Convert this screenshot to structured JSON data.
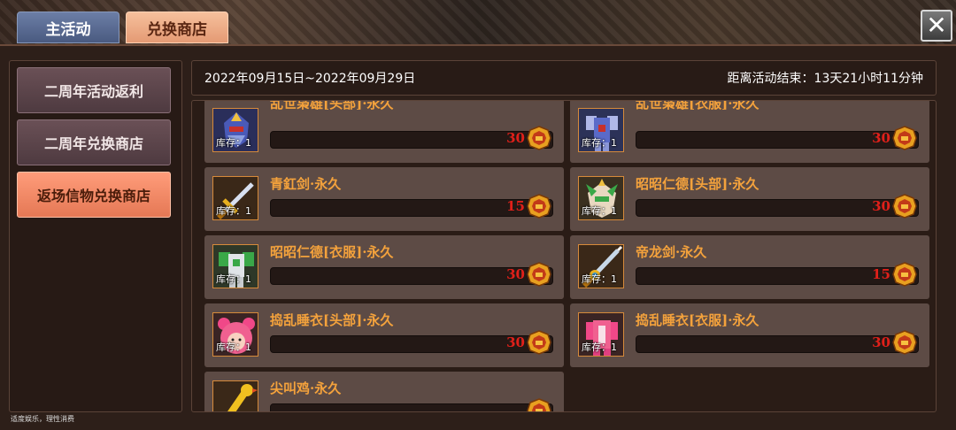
{
  "tabs": {
    "main_activity": "主活动",
    "exchange_shop": "兑换商店"
  },
  "close_glyph": "✕",
  "sidebar": {
    "items": [
      {
        "label": "二周年活动返利",
        "active": false
      },
      {
        "label": "二周年兑换商店",
        "active": false
      },
      {
        "label": "返场信物兑换商店",
        "active": true
      }
    ]
  },
  "date_bar": {
    "range": "2022年09月15日~2022年09月29日",
    "countdown": "距离活动结束：13天21小时11分钟"
  },
  "items": [
    {
      "name": "乱世枭雄[头部]·永久",
      "stock": "库存：1",
      "price": "30",
      "icon": "mecha-helmet-blue-icon"
    },
    {
      "name": "乱世枭雄[衣服]·永久",
      "stock": "库存：1",
      "price": "30",
      "icon": "mecha-armor-blue-icon"
    },
    {
      "name": "青釭剑·永久",
      "stock": "库存：1",
      "price": "15",
      "icon": "sword-gold-icon"
    },
    {
      "name": "昭昭仁德[头部]·永久",
      "stock": "库存：1",
      "price": "30",
      "icon": "mecha-helmet-green-icon"
    },
    {
      "name": "昭昭仁德[衣服]·永久",
      "stock": "库存：1",
      "price": "30",
      "icon": "mecha-armor-green-icon"
    },
    {
      "name": "帝龙剑·永久",
      "stock": "库存：1",
      "price": "15",
      "icon": "sword-dragon-icon"
    },
    {
      "name": "捣乱睡衣[头部]·永久",
      "stock": "库存：1",
      "price": "30",
      "icon": "pink-bear-hood-icon"
    },
    {
      "name": "捣乱睡衣[衣服]·永久",
      "stock": "库存：1",
      "price": "30",
      "icon": "pink-pajama-icon"
    },
    {
      "name": "尖叫鸡·永久",
      "stock": "",
      "price": "",
      "icon": "rubber-chicken-icon"
    }
  ],
  "footnote": "适度娱乐，理性消费",
  "colors": {
    "item_name": "#f4a23c",
    "price": "#e0201a",
    "active_tab": "#e49a74",
    "active_sidebar": "#e57855"
  }
}
